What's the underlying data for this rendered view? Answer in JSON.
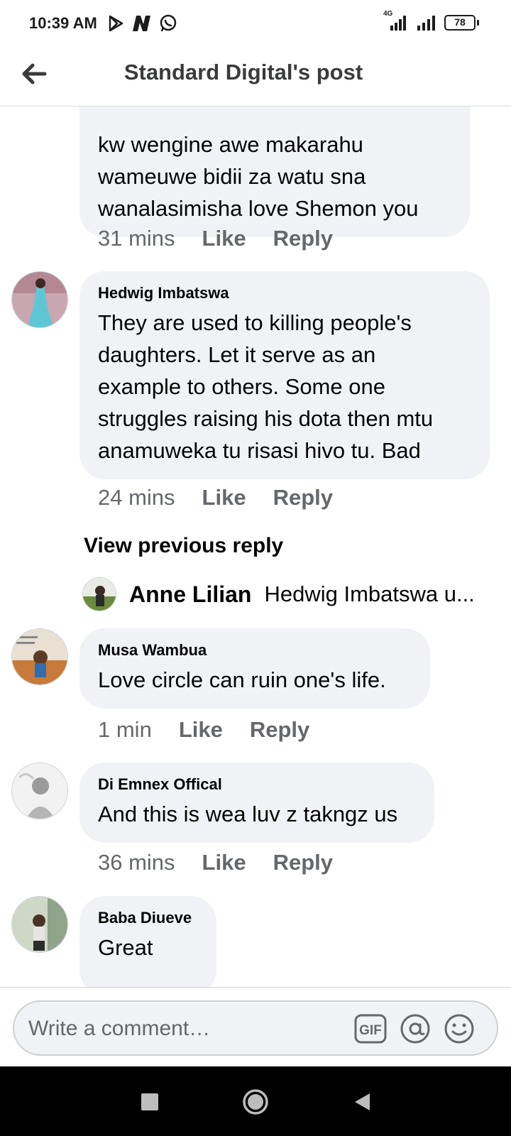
{
  "status": {
    "time": "10:39 AM",
    "network": "4G",
    "battery": "78"
  },
  "header": {
    "title": "Standard Digital's post"
  },
  "comments": [
    {
      "author": "",
      "lines": [
        "kw wengine awe makarahu",
        "wameuwe bidii za watu sna",
        "wanalasimisha love Shemon you"
      ],
      "time": "31 mins",
      "like": "Like",
      "reply": "Reply"
    },
    {
      "author": "Hedwig Imbatswa",
      "lines": [
        "They are used to killing people's",
        "daughters.  Let it serve  as an",
        "example to others. Some one",
        "struggles raising his dota then mtu",
        "anamuweka tu risasi hivo tu. Bad"
      ],
      "time": "24 mins",
      "like": "Like",
      "reply": "Reply"
    },
    {
      "author": "Musa Wambua",
      "lines": [
        "Love circle can ruin one's life."
      ],
      "time": "1 min",
      "like": "Like",
      "reply": "Reply"
    },
    {
      "author": "Di Emnex Offical",
      "lines": [
        "And this is wea luv z takngz us"
      ],
      "time": "36 mins",
      "like": "Like",
      "reply": "Reply"
    },
    {
      "author": "Baba Diueve",
      "lines": [
        "Great"
      ]
    }
  ],
  "view_previous": "View previous reply",
  "reply_preview": {
    "author": "Anne Lilian",
    "text": "Hedwig Imbatswa u..."
  },
  "composer": {
    "placeholder": "Write a comment…",
    "gif_label": "GIF"
  },
  "icons": {
    "back": "arrow-left-icon",
    "gif": "gif-icon",
    "mention": "at-sign-icon",
    "emoji": "smiley-icon"
  }
}
